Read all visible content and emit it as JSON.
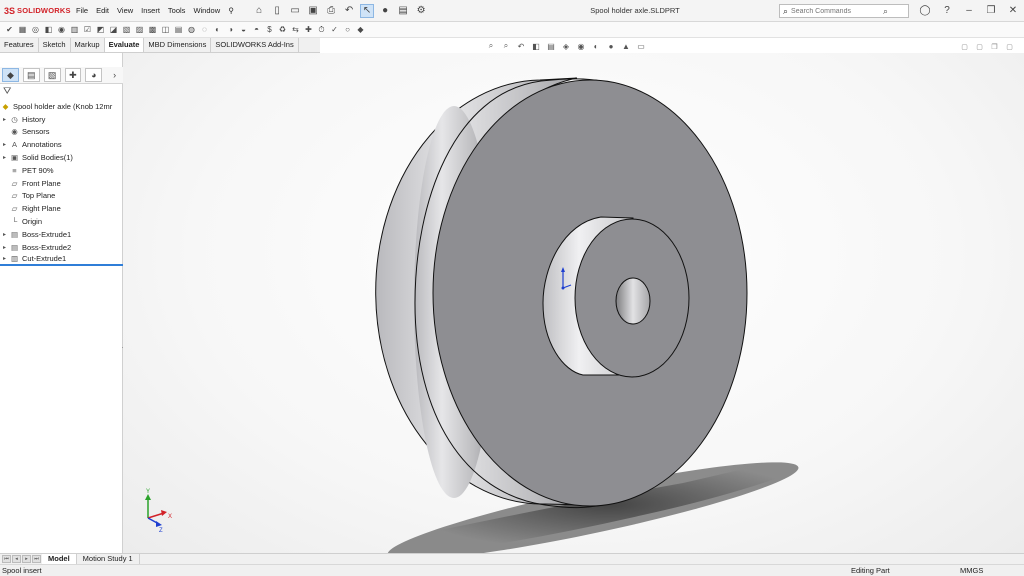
{
  "app": {
    "brand_mark": "3S",
    "brand_name": "SOLIDWORKS",
    "doc_title": "Spool holder axle.SLDPRT"
  },
  "menu": [
    "File",
    "Edit",
    "View",
    "Insert",
    "Tools",
    "Window"
  ],
  "search": {
    "placeholder": "Search Commands"
  },
  "tabs": [
    {
      "label": "Features",
      "active": false
    },
    {
      "label": "Sketch",
      "active": false
    },
    {
      "label": "Markup",
      "active": false
    },
    {
      "label": "Evaluate",
      "active": true
    },
    {
      "label": "MBD Dimensions",
      "active": false
    },
    {
      "label": "SOLIDWORKS Add-Ins",
      "active": false
    }
  ],
  "tree": {
    "root": "Spool holder axle  (Knob 12mr",
    "items": [
      {
        "label": "History",
        "icon": "history-icon",
        "expandable": true
      },
      {
        "label": "Sensors",
        "icon": "sensors-icon",
        "expandable": false
      },
      {
        "label": "Annotations",
        "icon": "annotations-icon",
        "expandable": true
      },
      {
        "label": "Solid Bodies(1)",
        "icon": "solid-bodies-icon",
        "expandable": true
      },
      {
        "label": "PET 90%",
        "icon": "material-icon",
        "expandable": false
      },
      {
        "label": "Front Plane",
        "icon": "plane-icon",
        "expandable": false
      },
      {
        "label": "Top Plane",
        "icon": "plane-icon",
        "expandable": false
      },
      {
        "label": "Right Plane",
        "icon": "plane-icon",
        "expandable": false
      },
      {
        "label": "Origin",
        "icon": "origin-icon",
        "expandable": false
      },
      {
        "label": "Boss-Extrude1",
        "icon": "extrude-icon",
        "expandable": true
      },
      {
        "label": "Boss-Extrude2",
        "icon": "extrude-icon",
        "expandable": true
      },
      {
        "label": "Cut-Extrude1",
        "icon": "cut-extrude-icon",
        "expandable": true
      }
    ]
  },
  "triad": {
    "x": "X",
    "y": "Y",
    "z": "Z"
  },
  "bottom_tabs": [
    {
      "label": "Model",
      "active": true
    },
    {
      "label": "Motion Study 1",
      "active": false
    }
  ],
  "status": {
    "left": "Spool insert",
    "mode": "Editing Part",
    "units": "MMGS"
  },
  "colors": {
    "accent": "#2f7ed8",
    "brand": "#d22128",
    "model_face": "#8e8e92"
  }
}
